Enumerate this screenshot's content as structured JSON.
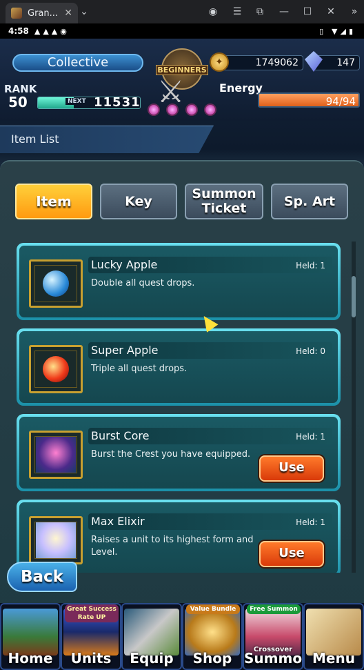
{
  "browser": {
    "tab_title": "Gran...",
    "tab_close": "✕",
    "menu_chevron": "⌄"
  },
  "statusbar": {
    "time": "4:58",
    "left_icons": "▲▲▲◉",
    "right_icons": "▯ ▼◢▮"
  },
  "header": {
    "player_name": "Collective",
    "emblem_text": "BEGINNERS",
    "gold": "1749062",
    "gems": "147",
    "rank_label": "RANK",
    "rank": "50",
    "next_label": "NEXT",
    "next_exp": "11531",
    "exp_progress": 0.35,
    "energy_label": "Energy",
    "energy": "94/94",
    "energy_fill": 1.0
  },
  "page": {
    "title": "Item List"
  },
  "tabs": [
    {
      "label": "Item",
      "active": true
    },
    {
      "label": "Key",
      "active": false
    },
    {
      "label": "Summon Ticket",
      "active": false
    },
    {
      "label": "Sp. Art",
      "active": false
    }
  ],
  "items": [
    {
      "name": "Lucky Apple",
      "held": "Held: 1",
      "desc": "Double all quest drops.",
      "icon": "blue-apple-icon",
      "has_use": false
    },
    {
      "name": "Super Apple",
      "held": "Held: 0",
      "desc": "Triple all quest drops.",
      "icon": "red-apple-icon",
      "has_use": false
    },
    {
      "name": "Burst Core",
      "held": "Held: 1",
      "desc": "Burst the Crest you have equipped.",
      "icon": "burst-core-icon",
      "has_use": true,
      "use_label": "Use"
    },
    {
      "name": "Max Elixir",
      "held": "Held: 1",
      "desc": "Raises a unit to its highest form and Level.",
      "icon": "max-elixir-icon",
      "has_use": true,
      "use_label": "Use"
    }
  ],
  "back_label": "Back",
  "nav": [
    {
      "label": "Home",
      "badge": "",
      "sub": ""
    },
    {
      "label": "Units",
      "badge": "Great Success Rate UP",
      "sub": ""
    },
    {
      "label": "Equip",
      "badge": "",
      "sub": ""
    },
    {
      "label": "Shop",
      "badge": "Value Bundle",
      "sub": ""
    },
    {
      "label": "Summon",
      "badge": "Free Summon",
      "sub": "Crossover"
    },
    {
      "label": "Menu",
      "badge": "",
      "sub": ""
    }
  ]
}
